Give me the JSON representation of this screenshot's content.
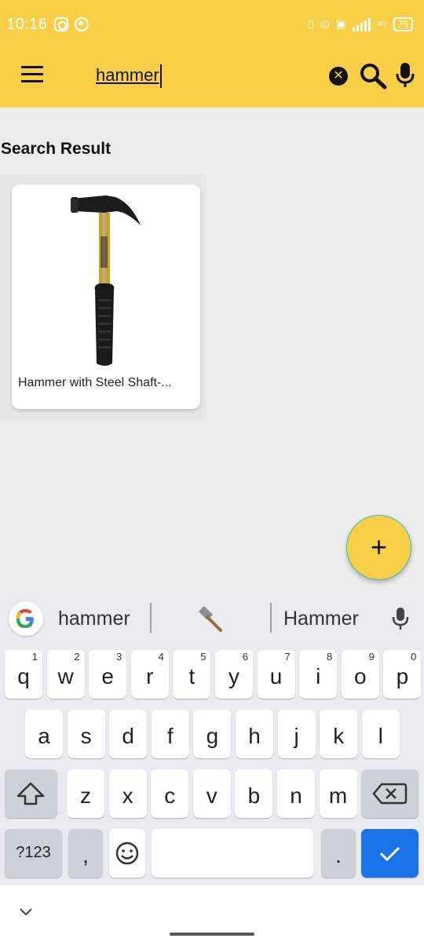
{
  "status_bar": {
    "time": "10:16",
    "network": "4G",
    "battery": "75"
  },
  "app_bar": {
    "search_value": "hammer"
  },
  "results": {
    "title": "Search Result",
    "items": [
      {
        "title": "Hammer with Steel Shaft-..."
      }
    ]
  },
  "fab": {
    "label": "+"
  },
  "keyboard": {
    "suggestions": [
      "hammer",
      "Hammer"
    ],
    "suggestion_emoji_icon": "hammer-icon",
    "row1": [
      {
        "c": "q",
        "h": "1"
      },
      {
        "c": "w",
        "h": "2"
      },
      {
        "c": "e",
        "h": "3"
      },
      {
        "c": "r",
        "h": "4"
      },
      {
        "c": "t",
        "h": "5"
      },
      {
        "c": "y",
        "h": "6"
      },
      {
        "c": "u",
        "h": "7"
      },
      {
        "c": "i",
        "h": "8"
      },
      {
        "c": "o",
        "h": "9"
      },
      {
        "c": "p",
        "h": "0"
      }
    ],
    "row2": [
      "a",
      "s",
      "d",
      "f",
      "g",
      "h",
      "j",
      "k",
      "l"
    ],
    "row3": [
      "z",
      "x",
      "c",
      "v",
      "b",
      "n",
      "m"
    ],
    "symbols_key": "?123",
    "comma_key": ",",
    "period_key": "."
  },
  "colors": {
    "accent": "#f9cf47",
    "enter_key": "#1a73e8"
  }
}
